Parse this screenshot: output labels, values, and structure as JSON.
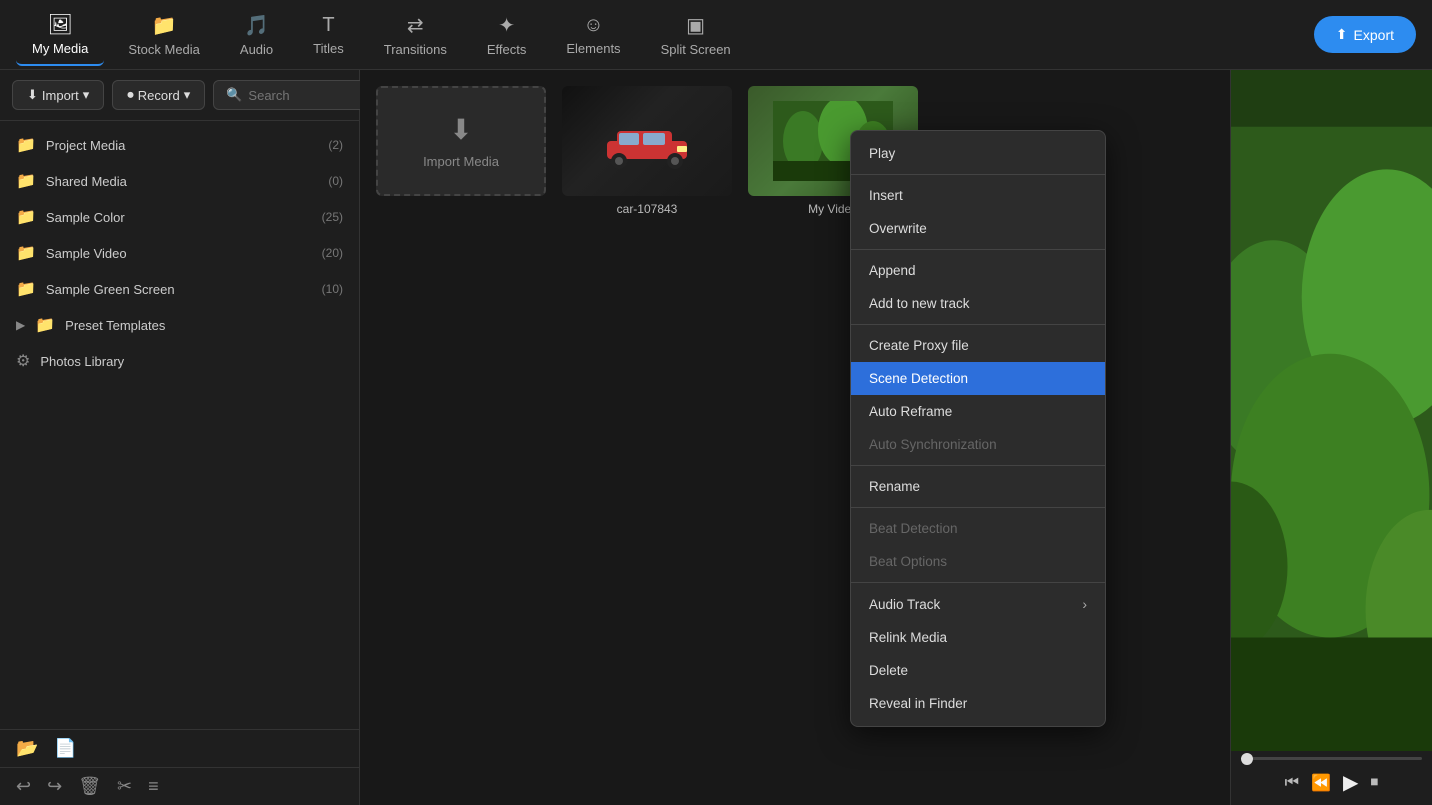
{
  "topnav": {
    "items": [
      {
        "id": "my-media",
        "label": "My Media",
        "icon": "🖼",
        "active": true
      },
      {
        "id": "stock-media",
        "label": "Stock Media",
        "icon": "📁",
        "active": false
      },
      {
        "id": "audio",
        "label": "Audio",
        "icon": "🎵",
        "active": false
      },
      {
        "id": "titles",
        "label": "Titles",
        "icon": "T",
        "active": false
      },
      {
        "id": "transitions",
        "label": "Transitions",
        "icon": "⇄",
        "active": false
      },
      {
        "id": "effects",
        "label": "Effects",
        "icon": "✦",
        "active": false
      },
      {
        "id": "elements",
        "label": "Elements",
        "icon": "☺",
        "active": false
      },
      {
        "id": "split-screen",
        "label": "Split Screen",
        "icon": "▣",
        "active": false
      }
    ],
    "export_label": "Export"
  },
  "toolbar": {
    "import_label": "Import",
    "record_label": "Record",
    "search_placeholder": "Search"
  },
  "sidebar": {
    "items": [
      {
        "id": "project-media",
        "label": "Project Media",
        "count": "(2)",
        "has_chevron": false
      },
      {
        "id": "shared-media",
        "label": "Shared Media",
        "count": "(0)",
        "has_chevron": false
      },
      {
        "id": "sample-color",
        "label": "Sample Color",
        "count": "(25)",
        "has_chevron": false
      },
      {
        "id": "sample-video",
        "label": "Sample Video",
        "count": "(20)",
        "has_chevron": false
      },
      {
        "id": "sample-green-screen",
        "label": "Sample Green Screen",
        "count": "(10)",
        "has_chevron": false
      },
      {
        "id": "preset-templates",
        "label": "Preset Templates",
        "count": "",
        "has_chevron": true
      },
      {
        "id": "photos-library",
        "label": "Photos Library",
        "count": "",
        "has_chevron": false
      }
    ],
    "footer_icons": [
      "↩",
      "↪",
      "🗑",
      "✂",
      "≡"
    ]
  },
  "media": {
    "tiles": [
      {
        "id": "import",
        "type": "import",
        "label": "Import Media"
      },
      {
        "id": "car-107843",
        "type": "car",
        "label": "car-107843"
      },
      {
        "id": "my-video",
        "type": "myvideo",
        "label": "My Video"
      }
    ]
  },
  "context_menu": {
    "items": [
      {
        "id": "play",
        "label": "Play",
        "disabled": false,
        "active": false,
        "has_arrow": false
      },
      {
        "id": "separator1",
        "type": "separator"
      },
      {
        "id": "insert",
        "label": "Insert",
        "disabled": false,
        "active": false,
        "has_arrow": false
      },
      {
        "id": "overwrite",
        "label": "Overwrite",
        "disabled": false,
        "active": false,
        "has_arrow": false
      },
      {
        "id": "separator2",
        "type": "separator"
      },
      {
        "id": "append",
        "label": "Append",
        "disabled": false,
        "active": false,
        "has_arrow": false
      },
      {
        "id": "add-to-new-track",
        "label": "Add to new track",
        "disabled": false,
        "active": false,
        "has_arrow": false
      },
      {
        "id": "separator3",
        "type": "separator"
      },
      {
        "id": "create-proxy-file",
        "label": "Create Proxy file",
        "disabled": false,
        "active": false,
        "has_arrow": false
      },
      {
        "id": "scene-detection",
        "label": "Scene Detection",
        "disabled": false,
        "active": true,
        "has_arrow": false
      },
      {
        "id": "auto-reframe",
        "label": "Auto Reframe",
        "disabled": false,
        "active": false,
        "has_arrow": false
      },
      {
        "id": "auto-synchronization",
        "label": "Auto Synchronization",
        "disabled": true,
        "active": false,
        "has_arrow": false
      },
      {
        "id": "separator4",
        "type": "separator"
      },
      {
        "id": "rename",
        "label": "Rename",
        "disabled": false,
        "active": false,
        "has_arrow": false
      },
      {
        "id": "separator5",
        "type": "separator"
      },
      {
        "id": "beat-detection",
        "label": "Beat Detection",
        "disabled": true,
        "active": false,
        "has_arrow": false
      },
      {
        "id": "beat-options",
        "label": "Beat Options",
        "disabled": true,
        "active": false,
        "has_arrow": false
      },
      {
        "id": "separator6",
        "type": "separator"
      },
      {
        "id": "audio-track",
        "label": "Audio Track",
        "disabled": false,
        "active": false,
        "has_arrow": true
      },
      {
        "id": "relink-media",
        "label": "Relink Media",
        "disabled": false,
        "active": false,
        "has_arrow": false
      },
      {
        "id": "delete",
        "label": "Delete",
        "disabled": false,
        "active": false,
        "has_arrow": false
      },
      {
        "id": "reveal-in-finder",
        "label": "Reveal in Finder",
        "disabled": false,
        "active": false,
        "has_arrow": false
      }
    ]
  },
  "preview": {
    "slider_position": 0,
    "controls": [
      "⏮",
      "⏹",
      "▶",
      "⏹"
    ]
  }
}
